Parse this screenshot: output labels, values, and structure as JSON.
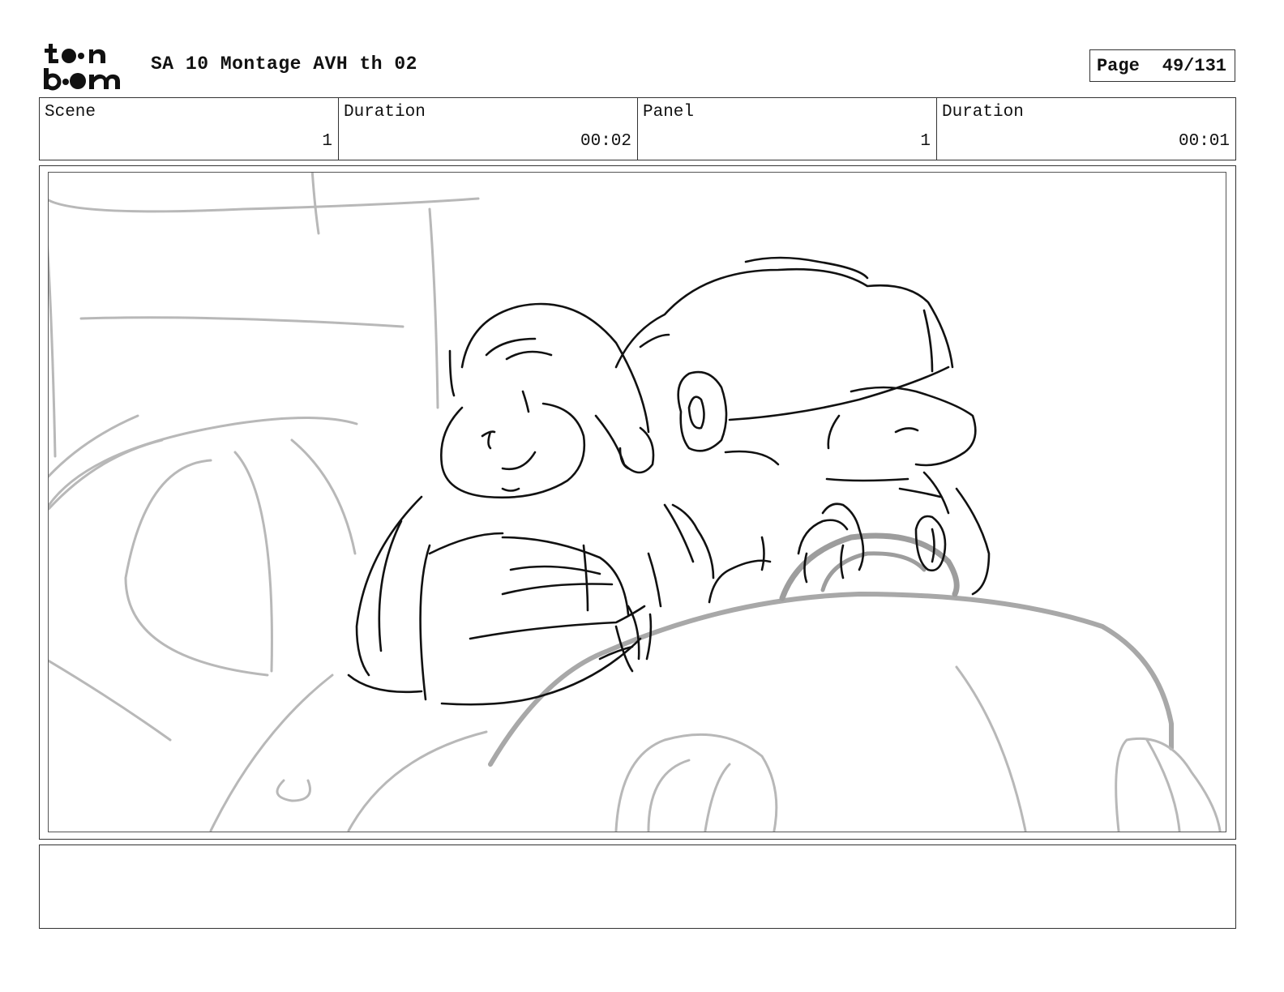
{
  "header": {
    "logo_line1": "to•n",
    "logo_line2": "b•om",
    "project_title": "SA 10 Montage AVH th 02",
    "page_label": "Page",
    "page_value": "49/131"
  },
  "info": {
    "scene_label": "Scene",
    "scene_value": "1",
    "scene_duration_label": "Duration",
    "scene_duration_value": "00:02",
    "panel_label": "Panel",
    "panel_value": "1",
    "panel_duration_label": "Duration",
    "panel_duration_value": "00:01"
  },
  "notes": {
    "text": ""
  }
}
